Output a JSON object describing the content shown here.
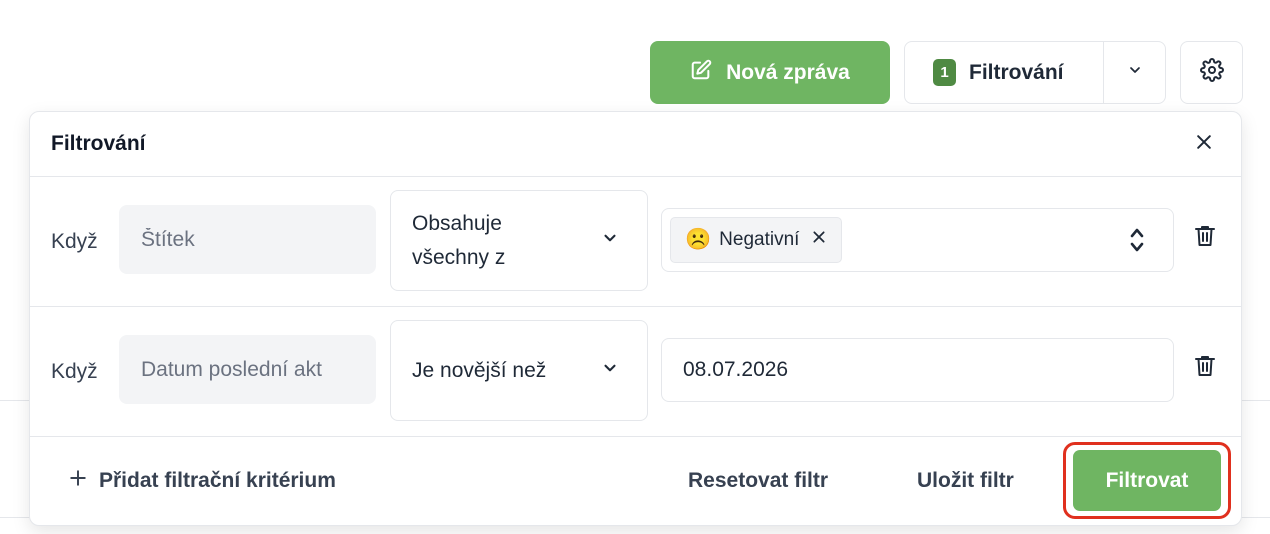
{
  "toolbar": {
    "new_message_label": "Nová zpráva",
    "filter_count": "1",
    "filter_label": "Filtrování"
  },
  "filter_panel": {
    "title": "Filtrování",
    "rows": [
      {
        "condition_label": "Když",
        "field_placeholder": "Štítek",
        "operator": "Obsahuje všechny z",
        "chips": [
          {
            "emoji": "☹️",
            "label": "Negativní"
          }
        ]
      },
      {
        "condition_label": "Když",
        "field_placeholder": "Datum poslední akt",
        "operator": "Je novější než",
        "value": "08.07.2026"
      }
    ],
    "add_criterion_label": "Přidat filtrační kritérium",
    "reset_label": "Resetovat filtr",
    "save_label": "Uložit filtr",
    "apply_label": "Filtrovat"
  },
  "colors": {
    "accent_green": "#6fb562",
    "badge_green": "#4f8a43",
    "highlight_red": "#e0301e"
  }
}
